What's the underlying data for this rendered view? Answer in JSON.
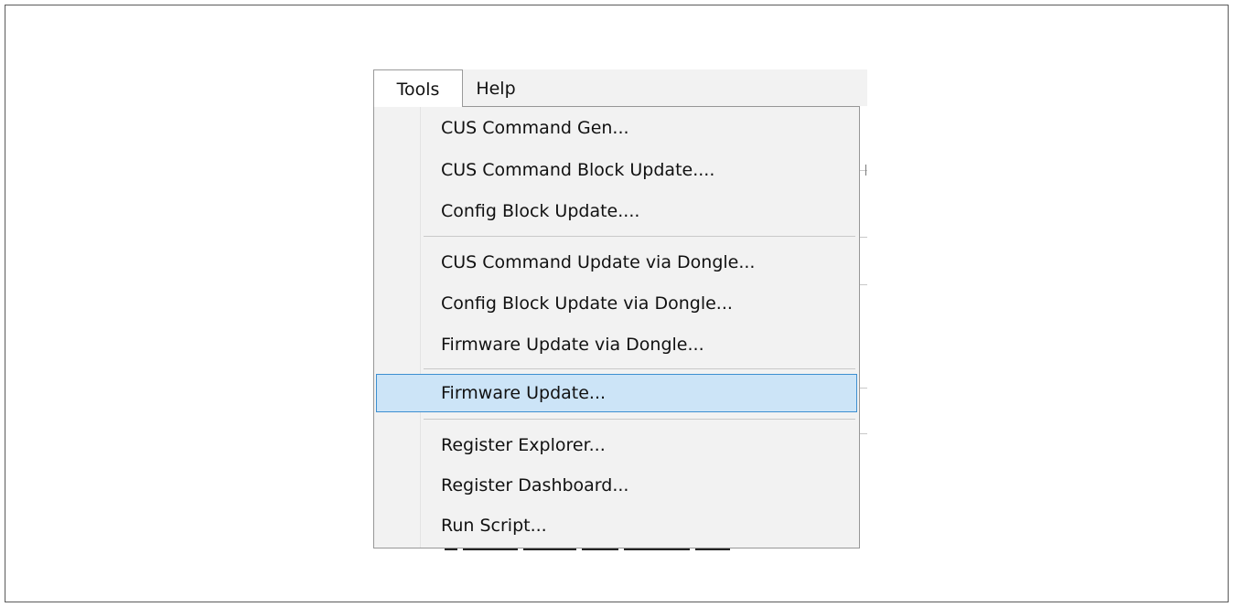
{
  "menubar": {
    "items": [
      {
        "label": "Tools"
      },
      {
        "label": "Help"
      }
    ]
  },
  "tools_menu": {
    "groups": [
      {
        "items": [
          {
            "label": "CUS Command Gen..."
          },
          {
            "label": "CUS Command Block Update...."
          },
          {
            "label": "Config Block Update...."
          }
        ]
      },
      {
        "items": [
          {
            "label": "CUS Command Update via Dongle..."
          },
          {
            "label": "Config Block Update via Dongle..."
          },
          {
            "label": "Firmware Update via Dongle..."
          }
        ]
      },
      {
        "items": [
          {
            "label": "Firmware Update...",
            "highlighted": true
          }
        ]
      },
      {
        "items": [
          {
            "label": "Register Explorer..."
          },
          {
            "label": "Register Dashboard..."
          },
          {
            "label": "Run Script..."
          }
        ]
      }
    ]
  },
  "colors": {
    "highlight_fill": "#cce4f7",
    "highlight_border": "#3d8fd1",
    "menu_background": "#f2f2f2"
  }
}
